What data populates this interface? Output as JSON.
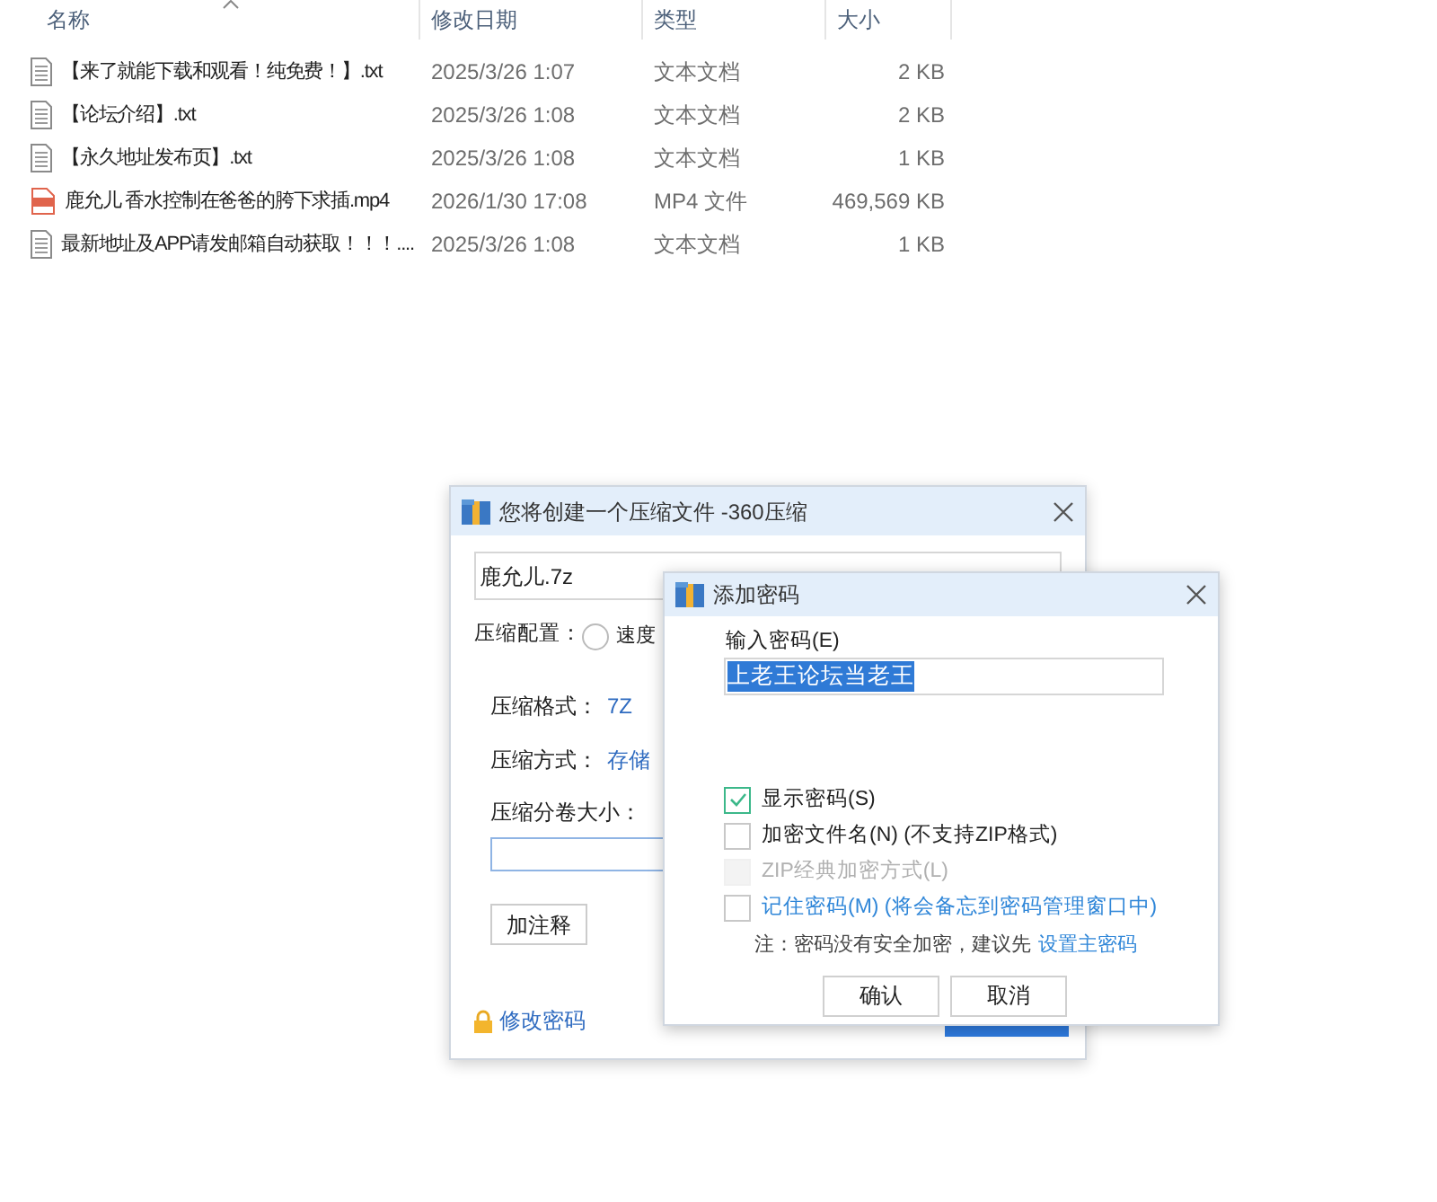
{
  "file_list": {
    "columns": [
      {
        "label": "名称",
        "sorted": true
      },
      {
        "label": "修改日期",
        "sorted": false
      },
      {
        "label": "类型",
        "sorted": false
      },
      {
        "label": "大小",
        "sorted": false
      }
    ],
    "rows": [
      {
        "kind": "text",
        "name": "【来了就能下载和观看！纯免费！】.txt",
        "date": "2025/3/26 1:07",
        "type": "文本文档",
        "size": "2 KB"
      },
      {
        "kind": "text",
        "name": "【论坛介绍】.txt",
        "date": "2025/3/26 1:08",
        "type": "文本文档",
        "size": "2 KB"
      },
      {
        "kind": "text",
        "name": "【永久地址发布页】.txt",
        "date": "2025/3/26 1:08",
        "type": "文本文档",
        "size": "1 KB"
      },
      {
        "kind": "video",
        "name": "鹿允儿 香水控制在爸爸的胯下求插.mp4",
        "date": "2026/1/30 17:08",
        "type": "MP4 文件",
        "size": "469,569 KB"
      },
      {
        "kind": "text",
        "name": "最新地址及APP请发邮箱自动获取！！！....",
        "date": "2025/3/26 1:08",
        "type": "文本文档",
        "size": "1 KB"
      }
    ]
  },
  "compress_dialog": {
    "title": "您将创建一个压缩文件 -360压缩",
    "filename": "鹿允儿.7z",
    "config_label": "压缩配置：",
    "config_option": {
      "label": "速度",
      "selected": false
    },
    "format_label": "压缩格式：",
    "format_value": "7Z",
    "method_label": "压缩方式：",
    "method_value": "存储",
    "split_label": "压缩分卷大小：",
    "comment_button": "加注释",
    "change_password_link": "修改密码"
  },
  "password_dialog": {
    "title": "添加密码",
    "password_label": "输入密码(E)",
    "password_value": "上老王论坛当老王",
    "options": [
      {
        "kind": "checkbox",
        "label": "显示密码(S)",
        "checked": true,
        "disabled": false
      },
      {
        "kind": "checkbox",
        "label": "加密文件名(N) (不支持ZIP格式)",
        "checked": false,
        "disabled": false
      },
      {
        "kind": "checkbox",
        "label": "ZIP经典加密方式(L)",
        "checked": false,
        "disabled": true
      },
      {
        "kind": "link",
        "label": "记住密码(M) (将会备忘到密码管理窗口中)",
        "checked": false,
        "disabled": false
      }
    ],
    "note": "注：密码没有安全加密，建议先",
    "note_link": "设置主密码",
    "buttons": [
      "确认",
      "取消"
    ]
  }
}
